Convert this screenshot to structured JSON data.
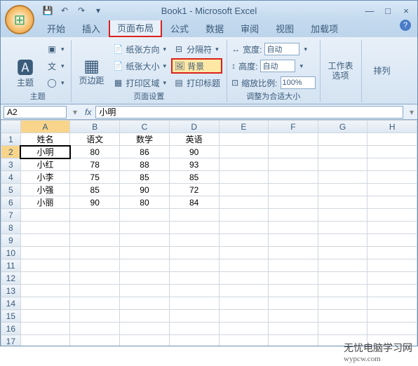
{
  "title": "Book1 - Microsoft Excel",
  "qat": {
    "save": "💾",
    "undo": "↶",
    "redo": "↷",
    "more": "▾"
  },
  "win": {
    "min": "—",
    "max": "□",
    "close": "×"
  },
  "tabs": [
    "开始",
    "插入",
    "页面布局",
    "公式",
    "数据",
    "审阅",
    "视图",
    "加载项"
  ],
  "active_tab_index": 2,
  "ribbon": {
    "g1": {
      "label": "主题",
      "themes": "主题",
      "colors": "▣",
      "fonts": "文",
      "effects": "◯"
    },
    "g2": {
      "label": "页面设置",
      "margins": "页边距",
      "orientation": "纸张方向",
      "size": "纸张大小",
      "printarea": "打印区域",
      "breaks": "分隔符",
      "background": "背景",
      "titles": "打印标题"
    },
    "g3": {
      "label": "调整为合适大小",
      "width_lbl": "宽度:",
      "width_val": "自动",
      "height_lbl": "高度:",
      "height_val": "自动",
      "scale_lbl": "缩放比例:",
      "scale_val": "100%"
    },
    "g4": {
      "sheetopts": "工作表选项"
    },
    "g5": {
      "arrange": "排列"
    }
  },
  "namebox": "A2",
  "fx_label": "fx",
  "formula": "小明",
  "columns": [
    "A",
    "B",
    "C",
    "D",
    "E",
    "F",
    "G",
    "H"
  ],
  "row_count": 18,
  "headers": [
    "姓名",
    "语文",
    "数学",
    "英语"
  ],
  "data": [
    [
      "小明",
      "80",
      "86",
      "90"
    ],
    [
      "小红",
      "78",
      "88",
      "93"
    ],
    [
      "小李",
      "75",
      "85",
      "85"
    ],
    [
      "小强",
      "85",
      "90",
      "72"
    ],
    [
      "小丽",
      "90",
      "80",
      "84"
    ]
  ],
  "selected_cell": {
    "row": 2,
    "col": 0
  },
  "watermark": {
    "line1": "无忧电脑学习网",
    "line2": "wypcw.com"
  },
  "help": "?"
}
